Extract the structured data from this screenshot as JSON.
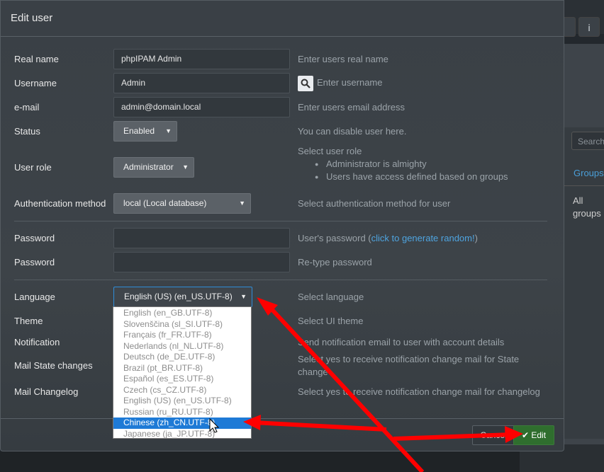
{
  "modal": {
    "title": "Edit user"
  },
  "form": {
    "real_name": {
      "label": "Real name",
      "value": "phpIPAM Admin",
      "help": "Enter users real name"
    },
    "username": {
      "label": "Username",
      "value": "Admin",
      "help": "Enter username"
    },
    "email": {
      "label": "e-mail",
      "value": "admin@domain.local",
      "help": "Enter users email address"
    },
    "status": {
      "label": "Status",
      "value": "Enabled",
      "help": "You can disable user here."
    },
    "role": {
      "label": "User role",
      "value": "Administrator",
      "help_title": "Select user role",
      "help_items": [
        "Administrator is almighty",
        "Users have access defined based on groups"
      ]
    },
    "auth": {
      "label": "Authentication method",
      "value": "local (Local database)",
      "help": "Select authentication method for user"
    },
    "password1": {
      "label": "Password",
      "value": "",
      "help_prefix": "User's password (",
      "help_link": "click to generate random!",
      "help_suffix": ")"
    },
    "password2": {
      "label": "Password",
      "value": "",
      "help": "Re-type password"
    },
    "language": {
      "label": "Language",
      "value": "English (US) (en_US.UTF-8)",
      "help": "Select language",
      "options": [
        "English (en_GB.UTF-8)",
        "Slovenščina (sl_SI.UTF-8)",
        "Français (fr_FR.UTF-8)",
        "Nederlands (nl_NL.UTF-8)",
        "Deutsch (de_DE.UTF-8)",
        "Brazil (pt_BR.UTF-8)",
        "Español (es_ES.UTF-8)",
        "Czech (cs_CZ.UTF-8)",
        "English (US) (en_US.UTF-8)",
        "Russian (ru_RU.UTF-8)",
        "Chinese (zh_CN.UTF-8)",
        "Japanese (ja_JP.UTF-8)"
      ],
      "highlighted": "Chinese (zh_CN.UTF-8)"
    },
    "theme": {
      "label": "Theme",
      "help": "Select UI theme"
    },
    "notification": {
      "label": "Notification",
      "help": "Send notification email to user with account details"
    },
    "mail_state": {
      "label": "Mail State changes",
      "help_line1": "Select yes to receive notification change mail for State",
      "help_line2": "change"
    },
    "mail_changelog": {
      "label": "Mail Changelog",
      "help": "Select yes to receive notification change mail for changelog"
    }
  },
  "footer": {
    "cancel_label": "Cancel",
    "edit_label": "Edit"
  },
  "background": {
    "search_placeholder": "Search",
    "groups_label": "Groups",
    "all_groups": "All groups",
    "info_icon": "i"
  },
  "colors": {
    "accent": "#1e7ad6",
    "success": "#2f6e2e",
    "link": "#4ea4e0",
    "arrow": "#ff0000"
  }
}
